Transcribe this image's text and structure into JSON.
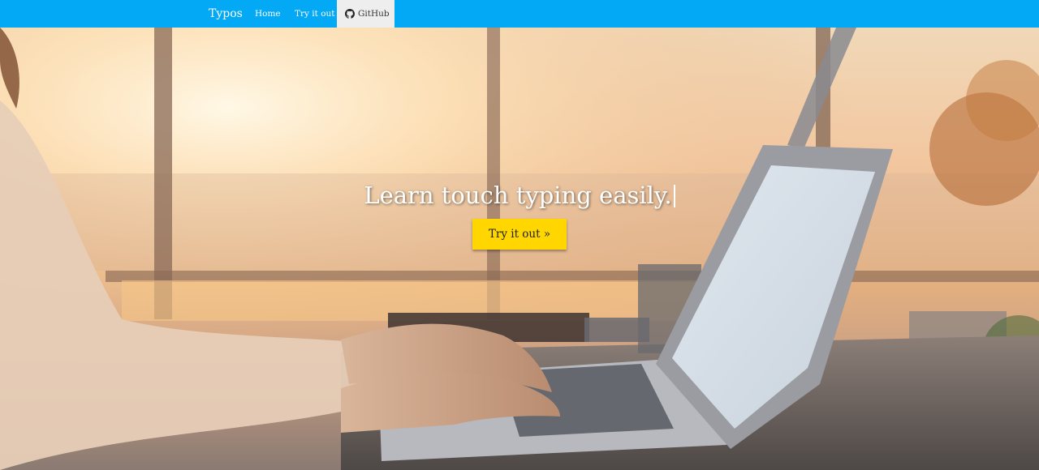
{
  "navbar": {
    "brand": "Typos",
    "links": [
      {
        "label": "Home"
      },
      {
        "label": "Try it out"
      },
      {
        "label": "GitHub",
        "icon": "github-icon"
      }
    ],
    "color": "#03a9f4"
  },
  "hero": {
    "headline": "Learn touch typing easily.",
    "cta_label": "Try it out »",
    "cta_color": "#ffd600"
  }
}
